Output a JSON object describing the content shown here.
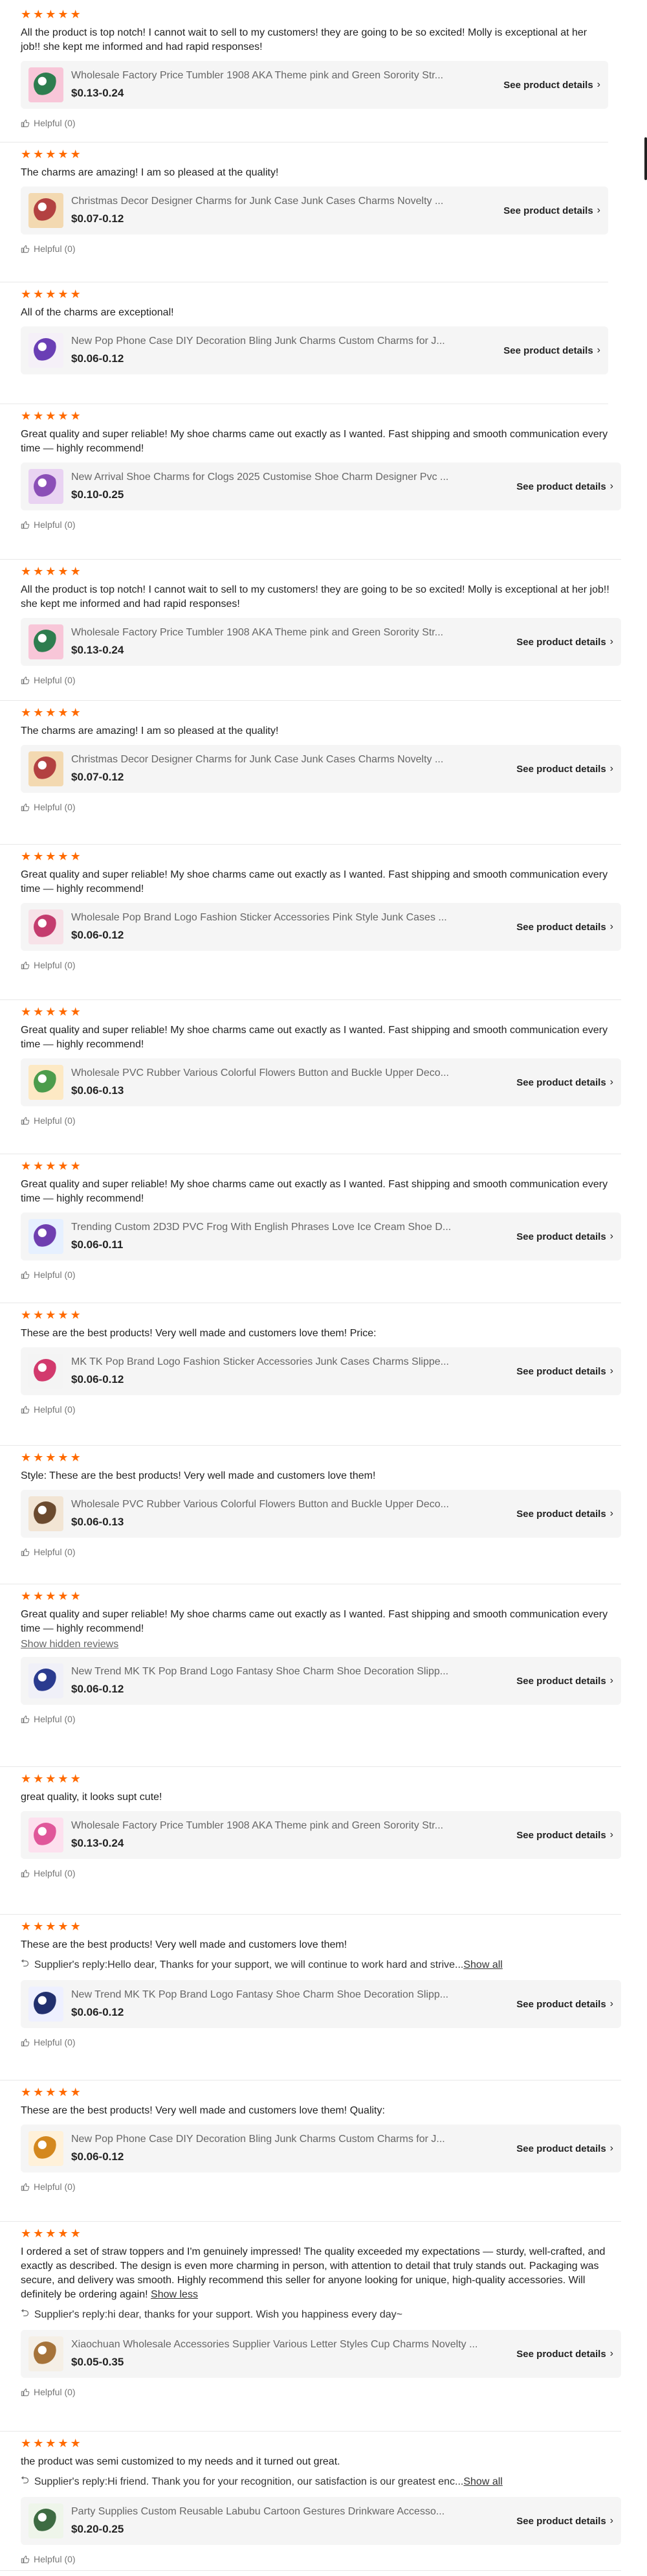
{
  "rating_star": "★",
  "chevron": "›",
  "reviews": [
    {
      "text": "All the product is top notch! I cannot wait to sell to my customers! they are going to be so excited! Molly is exceptional at her job!! she kept me informed and had rapid responses!",
      "product_name": "Wholesale Factory Price Tumbler 1908 AKA Theme pink and Green Sorority Str...",
      "price": "$0.13-0.24",
      "details": "See product details",
      "helpful": "Helpful (0)"
    },
    {
      "text": "The charms are amazing! I am so pleased at the quality!",
      "product_name": "Christmas Decor Designer Charms for Junk Case Junk Cases Charms Novelty ...",
      "price": "$0.07-0.12",
      "details": "See product details",
      "helpful": "Helpful (0)"
    },
    {
      "text": "All of the charms are exceptional!",
      "product_name": "New Pop Phone Case DIY Decoration Bling Junk Charms Custom Charms for J...",
      "price": "$0.06-0.12",
      "details": "See product details"
    },
    {
      "text": "Great quality and super reliable! My shoe charms came out exactly as I wanted. Fast shipping and smooth communication every time — highly recommend!",
      "product_name": "New Arrival Shoe Charms for Clogs 2025 Customise Shoe Charm Designer Pvc ...",
      "price": "$0.10-0.25",
      "details": "See product details",
      "helpful": "Helpful (0)"
    },
    {
      "text": "All the product is top notch! I cannot wait to sell to my customers! they are going to be so excited! Molly is exceptional at her job!! she kept me informed and had rapid responses!",
      "product_name": "Wholesale Factory Price Tumbler 1908 AKA Theme pink and Green Sorority Str...",
      "price": "$0.13-0.24",
      "details": "See product details",
      "helpful": "Helpful (0)"
    },
    {
      "text": "The charms are amazing! I am so pleased at the quality!",
      "product_name": "Christmas Decor Designer Charms for Junk Case Junk Cases Charms Novelty ...",
      "price": "$0.07-0.12",
      "details": "See product details",
      "helpful": "Helpful (0)"
    },
    {
      "text": "Great quality and super reliable! My shoe charms came out exactly as I wanted. Fast shipping and smooth communication every time — highly recommend!",
      "product_name": "Wholesale Pop Brand Logo Fashion Sticker Accessories Pink Style Junk Cases ...",
      "price": "$0.06-0.12",
      "details": "See product details",
      "helpful": "Helpful (0)"
    },
    {
      "text": "Great quality and super reliable! My shoe charms came out exactly as I wanted. Fast shipping and smooth communication every time — highly recommend!",
      "product_name": "Wholesale PVC Rubber Various Colorful Flowers Button and Buckle Upper Deco...",
      "price": "$0.06-0.13",
      "details": "See product details",
      "helpful": "Helpful (0)"
    },
    {
      "text": "Great quality and super reliable! My shoe charms came out exactly as I wanted. Fast shipping and smooth communication every time — highly recommend!",
      "product_name": "Trending Custom 2D3D PVC Frog With English Phrases Love Ice Cream Shoe D...",
      "price": "$0.06-0.11",
      "details": "See product details",
      "helpful": "Helpful (0)"
    },
    {
      "text": "These are the best products!  Very well made and customers love them! Price:",
      "product_name": "MK TK Pop Brand Logo Fashion Sticker Accessories Junk Cases Charms Slippe...",
      "price": "$0.06-0.12",
      "details": "See product details",
      "helpful": "Helpful (0)"
    },
    {
      "text": "Style: These are the best products!  Very well made and customers love them!",
      "product_name": "Wholesale PVC Rubber Various Colorful Flowers Button and Buckle Upper Deco...",
      "price": "$0.06-0.13",
      "details": "See product details",
      "helpful": "Helpful (0)"
    },
    {
      "text": "Great quality and super reliable! My shoe charms came out exactly as I wanted. Fast shipping and smooth communication every time — highly recommend!",
      "show_hidden": "Show hidden reviews",
      "product_name": "New Trend MK TK Pop Brand Logo Fantasy Shoe Charm Shoe Decoration Slipp...",
      "price": "$0.06-0.12",
      "details": "See product details",
      "helpful": "Helpful (0)"
    },
    {
      "text": "great quality, it looks supt cute!",
      "product_name": "Wholesale Factory Price Tumbler 1908 AKA Theme pink and Green Sorority Str...",
      "price": "$0.13-0.24",
      "details": "See product details",
      "helpful": "Helpful (0)"
    },
    {
      "text": "These are the best products!  Very well made and customers love them!",
      "reply_label": "Supplier's reply:",
      "reply_text": "Hello dear, Thanks for your support, we will continue to work hard and strive...",
      "reply_more": "Show all",
      "product_name": "New Trend MK TK Pop Brand Logo Fantasy Shoe Charm Shoe Decoration Slipp...",
      "price": "$0.06-0.12",
      "details": "See product details",
      "helpful": "Helpful (0)"
    },
    {
      "text": "These are the best products!  Very well made and customers love them! Quality:",
      "product_name": "New Pop Phone Case DIY Decoration Bling Junk Charms Custom Charms for J...",
      "price": "$0.06-0.12",
      "details": "See product details",
      "helpful": "Helpful (0)"
    },
    {
      "text": "I ordered a set of straw toppers and I'm genuinely impressed! The quality exceeded my expectations — sturdy, well-crafted, and exactly as described. The design is even more charming in person, with attention to detail that truly stands out. Packaging was secure, and delivery was smooth. Highly recommend this seller for anyone looking for unique, high-quality accessories. Will definitely be ordering again!",
      "text_more": "Show less",
      "reply_label": "Supplier's reply:",
      "reply_text": "hi dear, thanks for your support. Wish you happiness every day~",
      "product_name": "Xiaochuan Wholesale Accessories Supplier Various Letter Styles Cup Charms Novelty ...",
      "price": "$0.05-0.35",
      "details": "See product details",
      "helpful": "Helpful (0)"
    },
    {
      "text": "the product was semi customized to my needs and it turned out great.",
      "reply_label": "Supplier's reply:",
      "reply_text": "Hi friend. Thank you for your recognition, our satisfaction is our greatest enc...",
      "reply_more": "Show all",
      "product_name": "Party Supplies Custom Reusable Labubu Cartoon Gestures Drinkware Accesso...",
      "price": "$0.20-0.25",
      "details": "See product details",
      "helpful": "Helpful (0)"
    }
  ]
}
